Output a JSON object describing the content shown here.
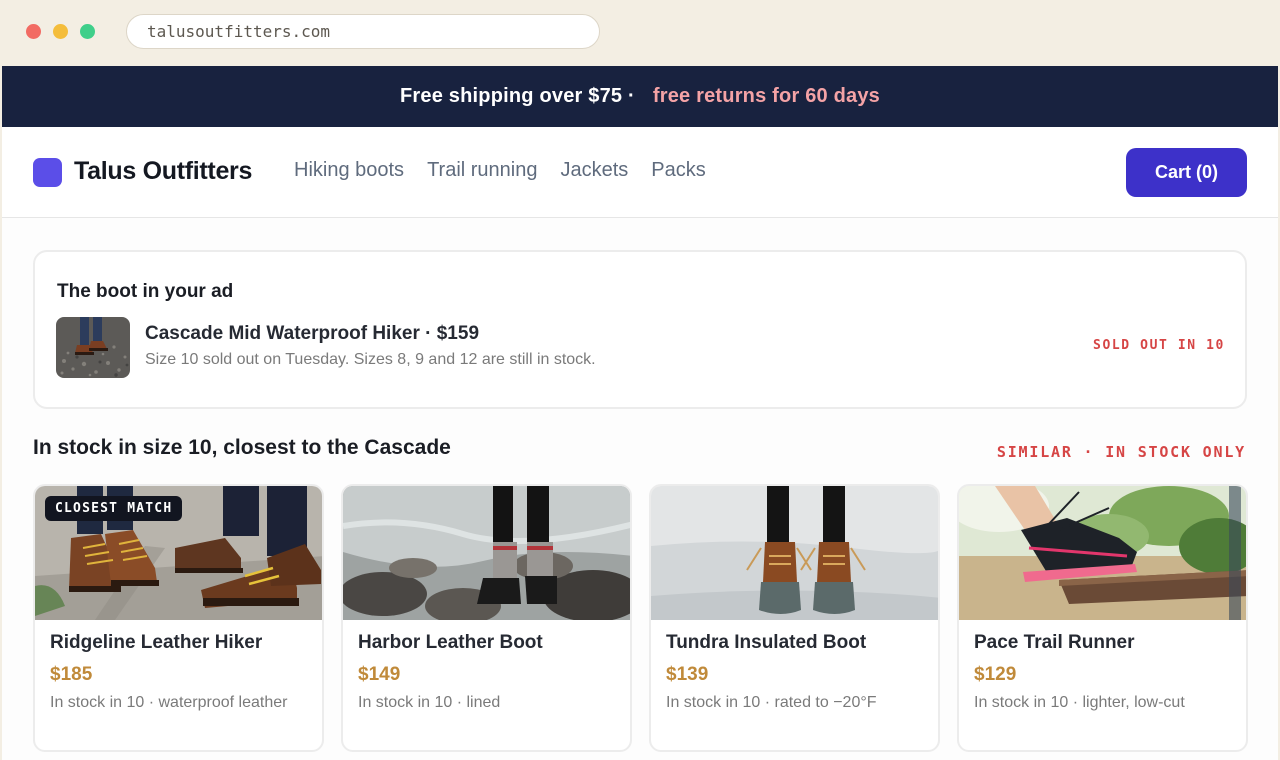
{
  "browser": {
    "url": "talusoutfitters.com"
  },
  "promo": {
    "text": "Free shipping over $75 ·",
    "accent": "free returns for 60 days"
  },
  "header": {
    "brand": "Talus Outfitters",
    "nav": [
      "Hiking boots",
      "Trail running",
      "Jackets",
      "Packs"
    ],
    "cart_label": "Cart (0)"
  },
  "ad_item": {
    "heading": "The boot in your ad",
    "name": "Cascade Mid Waterproof Hiker · $159",
    "note": "Size 10 sold out on Tuesday. Sizes 8, 9 and 12 are still in stock.",
    "tag": "SOLD OUT IN 10"
  },
  "similar": {
    "heading": "In stock in size 10, closest to the Cascade",
    "tag": "SIMILAR · IN STOCK ONLY",
    "products": [
      {
        "name": "Ridgeline Leather Hiker",
        "price": "$185",
        "note": "In stock in 10 · waterproof leather",
        "badge": "CLOSEST MATCH"
      },
      {
        "name": "Harbor Leather Boot",
        "price": "$149",
        "note": "In stock in 10 · lined"
      },
      {
        "name": "Tundra Insulated Boot",
        "price": "$139",
        "note": "In stock in 10 · rated to −20°F"
      },
      {
        "name": "Pace Trail Runner",
        "price": "$129",
        "note": "In stock in 10 · lighter, low-cut"
      }
    ]
  },
  "colors": {
    "brand": "#5b4ee8",
    "cart": "#3d31c9",
    "promo_bg": "#18223f",
    "promo_accent": "#f4a3a6",
    "alert": "#d64545",
    "price": "#c08a3a"
  }
}
